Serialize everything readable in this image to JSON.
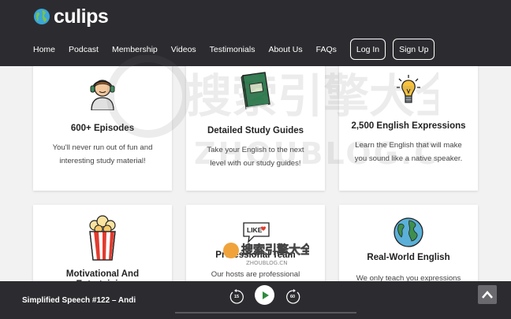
{
  "header": {
    "logo_text": "culips",
    "nav": [
      "Home",
      "Podcast",
      "Membership",
      "Videos",
      "Testimonials",
      "About Us",
      "FAQs"
    ],
    "login_label": "Log In",
    "signup_label": "Sign Up"
  },
  "cards": [
    {
      "title": "600+ Episodes",
      "desc": "You'll never run out of fun and interesting study material!",
      "icon": "headphones-person-icon"
    },
    {
      "title": "Detailed Study Guides",
      "desc": "Take your English to the next level with our study guides!",
      "icon": "book-icon"
    },
    {
      "title": "2,500 English Expressions",
      "desc": "Learn the English that will make you sound like a native speaker.",
      "icon": "lightbulb-icon"
    },
    {
      "title": "Motivational And Entertaining",
      "desc": "",
      "icon": "popcorn-icon"
    },
    {
      "title": "Professional Team",
      "desc": "Our hosts are professional",
      "icon": "like-speech-bubble-icon"
    },
    {
      "title": "Real-World English",
      "desc": "We only teach you expressions",
      "icon": "globe-icon"
    }
  ],
  "watermark": {
    "big_cn": "搜索引擎大全",
    "big_en": "ZHOUBLOG.CN",
    "small_cn": "搜索引擎大全",
    "small_en": "ZHOUBLOG.CN"
  },
  "player": {
    "track_title": "Simplified Speech #122 – Andi",
    "skip_back_seconds": "15",
    "skip_forward_seconds": "60"
  },
  "colors": {
    "header_bg": "#2c2c30",
    "card_bg": "#ffffff",
    "page_bg": "#f2f2f2"
  }
}
